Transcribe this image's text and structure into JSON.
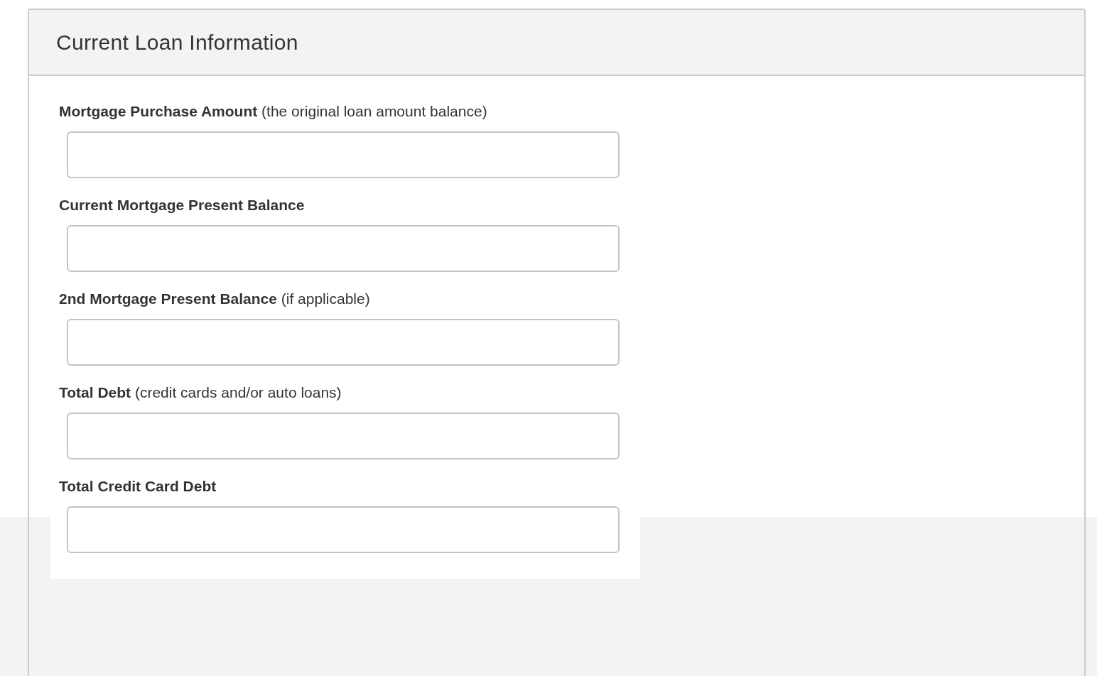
{
  "panel": {
    "title": "Current Loan Information"
  },
  "fields": [
    {
      "label": "**Mortgage Purchase Amount** (the original loan amount balance)"
    },
    {
      "label": "**Current Mortgage Present Balance**"
    },
    {
      "label": "**2nd Mortgage Present Balance** (if applicable)"
    },
    {
      "label": "**Total Debt** (credit cards and/or auto loans)"
    },
    {
      "label": "**Total Credit Card Debt**"
    }
  ]
}
